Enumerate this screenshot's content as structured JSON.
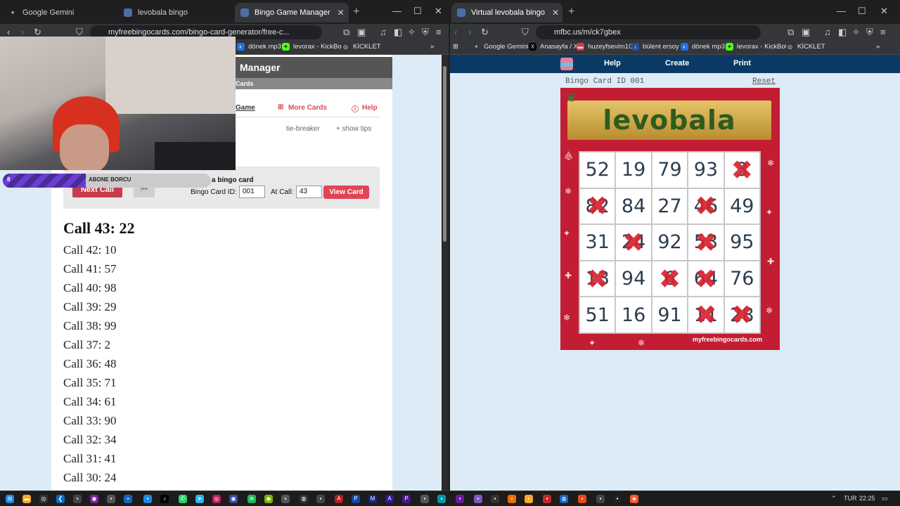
{
  "left_window": {
    "tabs": [
      {
        "label": "Google Gemini",
        "icon": "gemini-icon"
      },
      {
        "label": "levobala bingo",
        "icon": "page-icon"
      },
      {
        "label": "Bingo Game Manager",
        "icon": "page-icon",
        "active": true
      }
    ],
    "url": "myfreebingocards.com/bingo-card-generator/free-c...",
    "bookmarks": [
      "dönek mp3",
      "levorax - KickBot",
      "KİCKLET"
    ],
    "page": {
      "header_title": "Manager",
      "subheader": "Cards",
      "links": {
        "game": "Game",
        "more_cards": "More Cards",
        "help": "Help"
      },
      "tie_breaker": "tie-breaker",
      "show_tips": "+ show tips",
      "next_call_label": "Next Call",
      "verify_label": "Verify a bingo card",
      "card_id_label": "Bingo Card ID:",
      "card_id_value": "001",
      "at_call_label": "At Call:",
      "at_call_value": "43",
      "view_card_label": "View Card",
      "current_call": "Call 43: 22",
      "calls": [
        "Call 42: 10",
        "Call 41: 57",
        "Call 40: 98",
        "Call 39: 29",
        "Call 38: 99",
        "Call 37: 2",
        "Call 36: 48",
        "Call 35: 71",
        "Call 34: 61",
        "Call 33: 90",
        "Call 32: 34",
        "Call 31: 41",
        "Call 30: 24"
      ]
    },
    "overlay": {
      "alert_text": "ABONE BORCU",
      "alert_count": "8",
      "alert_progress": 0.4
    }
  },
  "right_window": {
    "tab": {
      "label": "Virtual levobala bingo"
    },
    "url": "mfbc.us/m/ck7gbex",
    "bookmarks": [
      "Google Gemini",
      "Anasayfa / X",
      "huzeyfsevim10",
      "bülent ersoy",
      "dönek mp3",
      "levorax - KickBot",
      "KİCKLET"
    ],
    "nav": {
      "help": "Help",
      "create": "Create",
      "print": "Print"
    },
    "card_id": "Bingo Card ID 001",
    "reset": "Reset",
    "card_title": "levobala",
    "watermark": "myfreebingocards.com",
    "grid": [
      [
        {
          "n": "52",
          "x": false
        },
        {
          "n": "19",
          "x": false
        },
        {
          "n": "79",
          "x": false
        },
        {
          "n": "93",
          "x": false
        },
        {
          "n": "3",
          "x": true
        }
      ],
      [
        {
          "n": "82",
          "x": true
        },
        {
          "n": "84",
          "x": false
        },
        {
          "n": "27",
          "x": false
        },
        {
          "n": "46",
          "x": true
        },
        {
          "n": "49",
          "x": false
        }
      ],
      [
        {
          "n": "31",
          "x": false
        },
        {
          "n": "24",
          "x": true
        },
        {
          "n": "92",
          "x": false
        },
        {
          "n": "53",
          "x": true
        },
        {
          "n": "95",
          "x": false
        }
      ],
      [
        {
          "n": "13",
          "x": true
        },
        {
          "n": "94",
          "x": false
        },
        {
          "n": "6",
          "x": true
        },
        {
          "n": "64",
          "x": true
        },
        {
          "n": "76",
          "x": false
        }
      ],
      [
        {
          "n": "51",
          "x": false
        },
        {
          "n": "16",
          "x": false
        },
        {
          "n": "91",
          "x": false
        },
        {
          "n": "11",
          "x": true
        },
        {
          "n": "28",
          "x": true
        }
      ]
    ]
  },
  "taskbar": {
    "lang": "TUR",
    "time": "22:25"
  }
}
